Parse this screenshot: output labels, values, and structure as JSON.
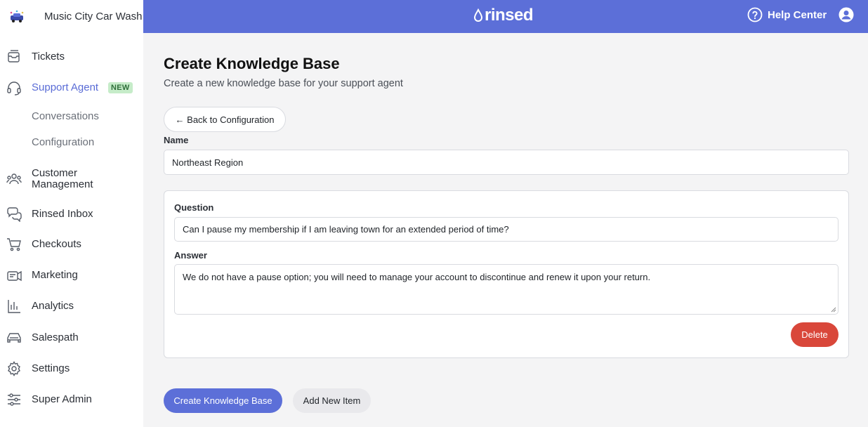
{
  "brand": {
    "name": "Music City Car Wash",
    "logo_icon": "car-wash-logo"
  },
  "topbar": {
    "logo_text": "rinsed",
    "logo_icon": "water-drop-icon",
    "help_label": "Help Center",
    "help_icon": "question-circle-icon",
    "user_icon": "user-avatar-icon",
    "color": "#5c6fd8"
  },
  "sidebar": {
    "items": [
      {
        "label": "Tickets",
        "icon": "ticket-icon"
      },
      {
        "label": "Support Agent",
        "icon": "headset-icon",
        "badge": "NEW",
        "active": true,
        "children": [
          {
            "label": "Conversations"
          },
          {
            "label": "Configuration"
          }
        ]
      },
      {
        "label": "Customer Management",
        "label_line1": "Customer",
        "label_line2": "Management",
        "icon": "users-icon"
      },
      {
        "label": "Rinsed Inbox",
        "icon": "chat-bubbles-icon"
      },
      {
        "label": "Checkouts",
        "icon": "cart-icon"
      },
      {
        "label": "Marketing",
        "icon": "megaphone-icon"
      },
      {
        "label": "Analytics",
        "icon": "bar-chart-icon"
      },
      {
        "label": "Salespath",
        "icon": "car-icon"
      },
      {
        "label": "Settings",
        "icon": "gear-icon"
      },
      {
        "label": "Super Admin",
        "icon": "sliders-icon"
      }
    ]
  },
  "page": {
    "title": "Create Knowledge Base",
    "subtitle": "Create a new knowledge base for your support agent",
    "back_label": "← Back to Configuration",
    "name_label": "Name",
    "name_value": "Northeast Region",
    "item": {
      "question_label": "Question",
      "question_value": "Can I pause my membership if I am leaving town for an extended period of time?",
      "answer_label": "Answer",
      "answer_value": "We do not have a pause option; you will need to manage your account to discontinue and renew it upon your return.",
      "delete_label": "Delete"
    },
    "create_label": "Create Knowledge Base",
    "add_label": "Add New Item"
  },
  "colors": {
    "accent": "#5c6fd8",
    "danger": "#d9473a",
    "badge_bg": "#c6ecc9"
  }
}
